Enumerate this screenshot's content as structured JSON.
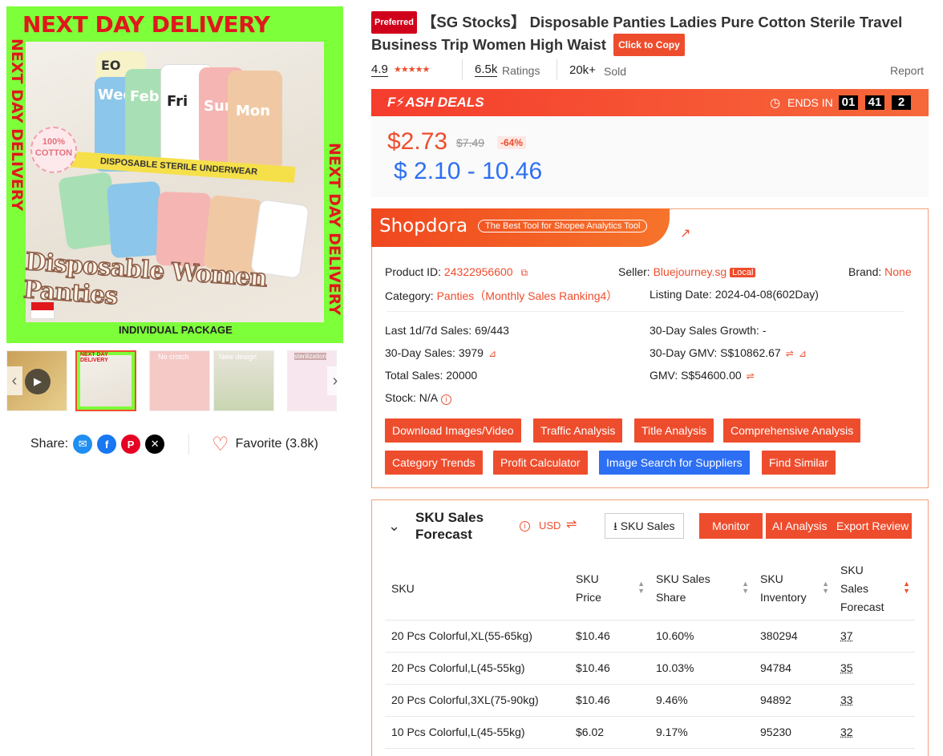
{
  "product_image": {
    "banner_top": "NEXT DAY DELIVERY",
    "banner_side": "NEXT DAY DELIVERY",
    "cotton_badge": "100% COTTON",
    "strip_text": "DISPOSABLE STERILE UNDERWEAR",
    "title_art": "Disposable Women Panties",
    "package_foot": "INDIVIDUAL PACKAGE",
    "package_days": [
      "EO",
      "Wed",
      "Feb",
      "Fri",
      "Sun",
      "Mon"
    ]
  },
  "thumbnails": [
    {
      "label": "",
      "color": "#d9b46a"
    },
    {
      "label": "NEXT DAY DELIVERY",
      "color": "#7dff3a"
    },
    {
      "label": "No crotch",
      "color": "#f2b8b8"
    },
    {
      "label": "New design",
      "color": "#c8d8b0"
    },
    {
      "label": "sterilization",
      "color": "#f5c6d6"
    }
  ],
  "share": {
    "label": "Share:",
    "favorite": "Favorite (3.8k)"
  },
  "title": {
    "badge": "Preferred",
    "text": "【SG Stocks】 Disposable Panties Ladies Pure Cotton Sterile Travel Business Trip Women High Waist",
    "copy_button": "Click to Copy"
  },
  "ratings": {
    "score": "4.9",
    "count": "6.5k",
    "count_label": "Ratings",
    "sold": "20k+",
    "sold_label": "Sold",
    "report": "Report"
  },
  "flash": {
    "logo": "F⚡ASH DEALS",
    "ends_label": "ENDS IN",
    "hours": "01",
    "minutes": "41",
    "seconds": "2"
  },
  "price": {
    "current": "$2.73",
    "original": "$7.49",
    "discount": "-64%",
    "usd_range": "$ 2.10 - 10.46"
  },
  "shopdora": {
    "logo": "Shopdora",
    "tagline": "The Best Tool for Shopee Analytics Tool",
    "product_id_label": "Product ID:",
    "product_id": "24322956600",
    "seller_label": "Seller:",
    "seller": "Bluejourney.sg",
    "seller_badge": "Local",
    "brand_label": "Brand:",
    "brand": "None",
    "category_label": "Category:",
    "category": "Panties（Monthly Sales Ranking4）",
    "listing_label": "Listing Date:",
    "listing": "2024-04-08(602Day)",
    "last_sales": "Last 1d/7d Sales: 69/443",
    "growth": "30-Day Sales Growth: -",
    "sales30": "30-Day Sales: 3979",
    "gmv30": "30-Day GMV: S$10862.67",
    "total_sales": "Total Sales: 20000",
    "gmv": "GMV: S$54600.00",
    "stock": "Stock: N/A",
    "buttons_row1": [
      "Download Images/Video",
      "Traffic Analysis",
      "Title Analysis",
      "Comprehensive Analysis"
    ],
    "buttons_row2": [
      "Category Trends",
      "Profit Calculator",
      "Image Search for Suppliers",
      "Find Similar"
    ]
  },
  "sku": {
    "title": "SKU Sales Forecast",
    "currency": "USD",
    "sales_button": "SKU Sales",
    "monitor": "Monitor",
    "ai": "AI Analysis",
    "export": "Export Review",
    "columns": [
      "SKU",
      "SKU Price",
      "SKU Sales Share",
      "SKU Inventory",
      "SKU Sales Forecast"
    ],
    "rows": [
      [
        "20 Pcs Colorful,XL(55-65kg)",
        "$10.46",
        "10.60%",
        "380294",
        "37"
      ],
      [
        "20 Pcs Colorful,L(45-55kg)",
        "$10.46",
        "10.03%",
        "94784",
        "35"
      ],
      [
        "20 Pcs Colorful,3XL(75-90kg)",
        "$10.46",
        "9.46%",
        "94892",
        "33"
      ],
      [
        "10 Pcs Colorful,L(45-55kg)",
        "$6.02",
        "9.17%",
        "95230",
        "32"
      ]
    ]
  },
  "colors": {
    "accent": "#ee4d2d",
    "blue": "#2d6ff3",
    "lime": "#7dff3a"
  }
}
